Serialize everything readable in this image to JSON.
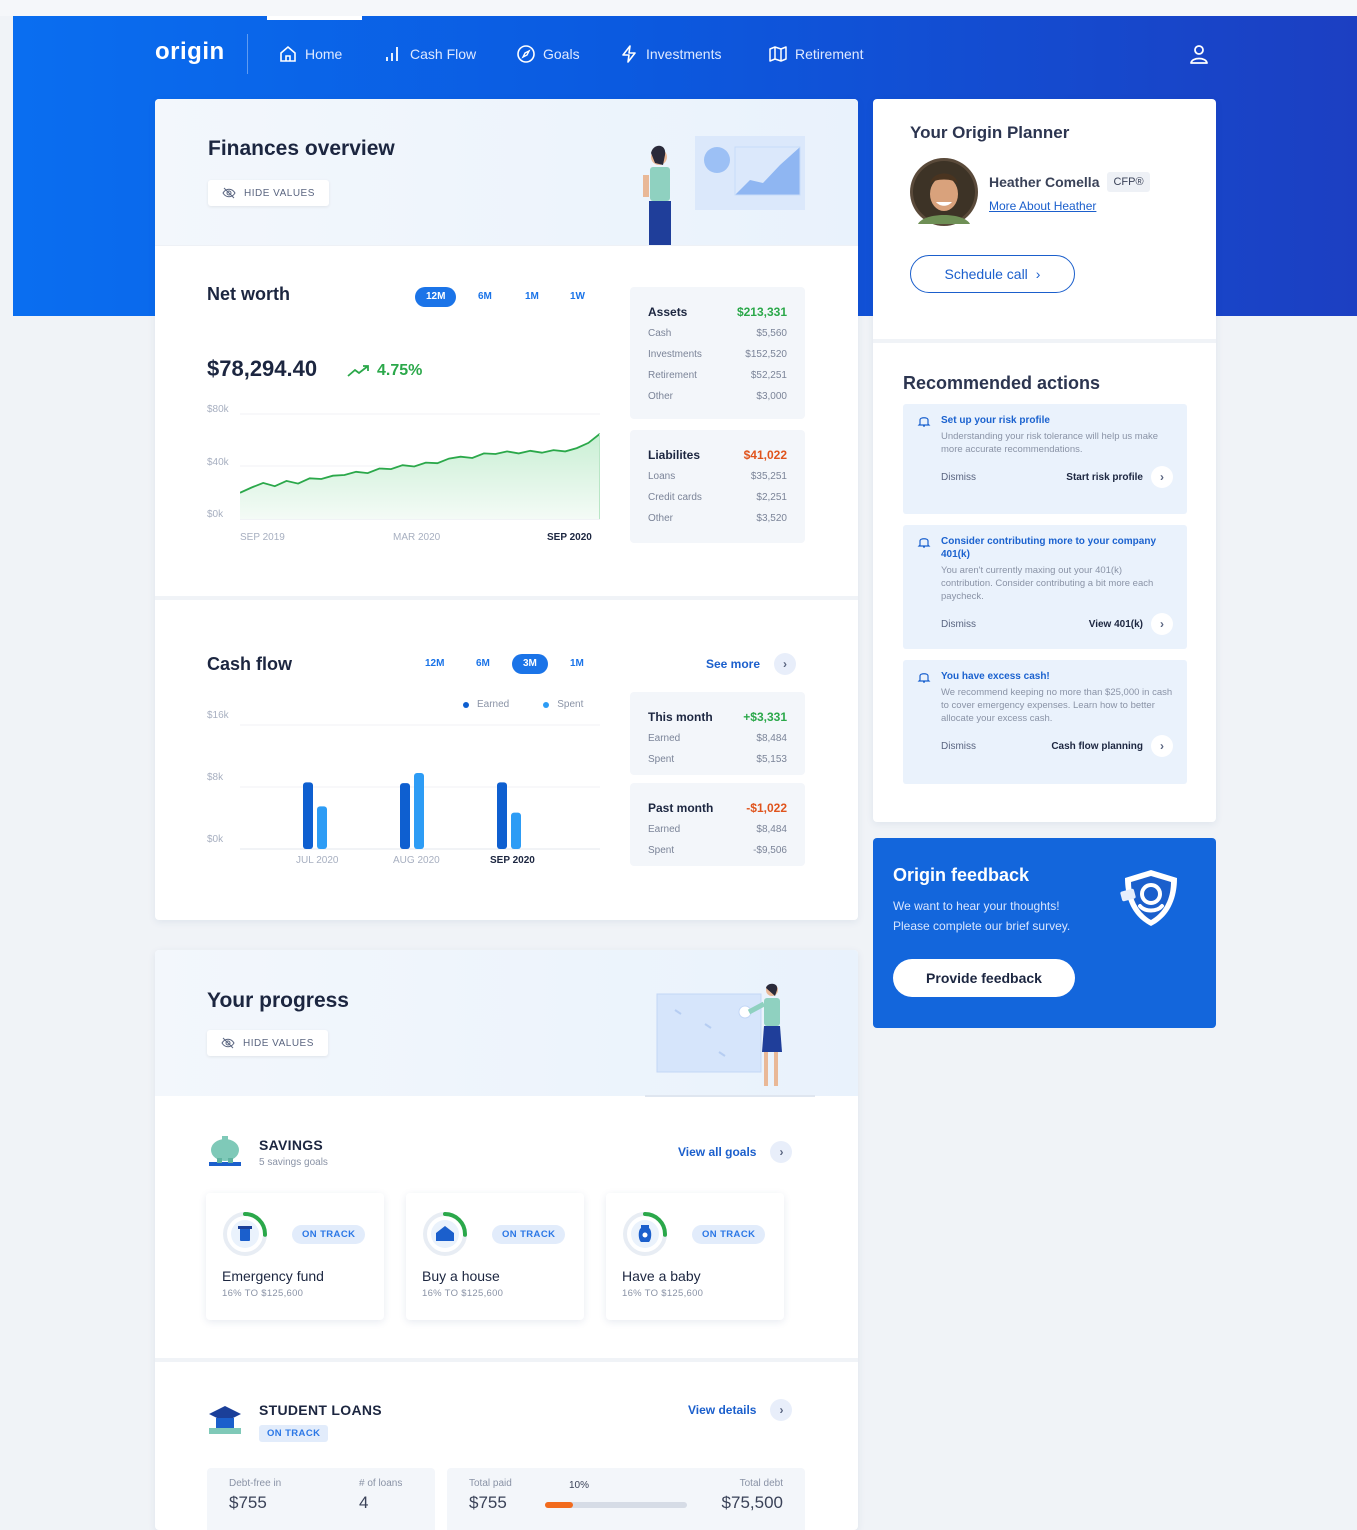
{
  "nav": {
    "logo": "origin",
    "items": [
      {
        "label": "Home",
        "icon": "home-icon"
      },
      {
        "label": "Cash Flow",
        "icon": "bar-chart-icon"
      },
      {
        "label": "Goals",
        "icon": "compass-icon"
      },
      {
        "label": "Investments",
        "icon": "lightning-icon"
      },
      {
        "label": "Retirement",
        "icon": "map-icon"
      }
    ],
    "user_icon": "user-icon"
  },
  "overview": {
    "title": "Finances overview",
    "hide_values": "HIDE VALUES"
  },
  "net_worth": {
    "title": "Net worth",
    "ranges": [
      "12M",
      "6M",
      "1M",
      "1W"
    ],
    "active_range": "12M",
    "value": "$78,294.40",
    "change": "4.75%",
    "assets": {
      "label": "Assets",
      "total": "$213,331",
      "rows": [
        {
          "label": "Cash",
          "value": "$5,560"
        },
        {
          "label": "Investments",
          "value": "$152,520"
        },
        {
          "label": "Retirement",
          "value": "$52,251"
        },
        {
          "label": "Other",
          "value": "$3,000"
        }
      ]
    },
    "liabilities": {
      "label": "Liabilites",
      "total": "$41,022",
      "rows": [
        {
          "label": "Loans",
          "value": "$35,251"
        },
        {
          "label": "Credit cards",
          "value": "$2,251"
        },
        {
          "label": "Other",
          "value": "$3,520"
        }
      ]
    }
  },
  "cash_flow": {
    "title": "Cash flow",
    "ranges": [
      "12M",
      "6M",
      "3M",
      "1M"
    ],
    "active_range": "3M",
    "see_more": "See more",
    "legend": {
      "earned": "Earned",
      "spent": "Spent"
    },
    "this_month": {
      "label": "This month",
      "total": "+$3,331",
      "rows": [
        {
          "label": "Earned",
          "value": "$8,484"
        },
        {
          "label": "Spent",
          "value": "$5,153"
        }
      ]
    },
    "past_month": {
      "label": "Past month",
      "total": "-$1,022",
      "rows": [
        {
          "label": "Earned",
          "value": "$8,484"
        },
        {
          "label": "Spent",
          "value": "-$9,506"
        }
      ]
    }
  },
  "chart_data": [
    {
      "type": "area",
      "title": "Net worth",
      "x_ticks": [
        "SEP 2019",
        "MAR 2020",
        "SEP 2020"
      ],
      "y_ticks": [
        "$80k",
        "$40k",
        "$0k"
      ],
      "ylim": [
        0,
        80000
      ],
      "values": [
        20000,
        24000,
        27500,
        25000,
        29000,
        27000,
        31000,
        30500,
        33000,
        33500,
        36000,
        35000,
        38500,
        38000,
        41000,
        40000,
        43000,
        42500,
        46000,
        47500,
        46500,
        50000,
        49500,
        51500,
        50000,
        52000,
        50500,
        52500,
        51500,
        54000,
        58000,
        65000
      ]
    },
    {
      "type": "bar",
      "title": "Cash flow",
      "categories": [
        "JUL 2020",
        "AUG 2020",
        "SEP 2020"
      ],
      "y_ticks": [
        "$16k",
        "$8k",
        "$0k"
      ],
      "ylim": [
        0,
        16000
      ],
      "series": [
        {
          "name": "Earned",
          "values": [
            8600,
            8500,
            8600
          ],
          "color": "#0e5fd0"
        },
        {
          "name": "Spent",
          "values": [
            5500,
            9800,
            4700
          ],
          "color": "#2d9cf5"
        }
      ]
    }
  ],
  "planner": {
    "title": "Your Origin Planner",
    "name": "Heather Comella",
    "credential": "CFP®",
    "link": "More About Heather",
    "schedule": "Schedule call"
  },
  "recommended": {
    "title": "Recommended actions",
    "items": [
      {
        "title": "Set up your risk profile",
        "desc": "Understanding your risk tolerance will help us make more accurate recommendations.",
        "dismiss": "Dismiss",
        "cta": "Start risk profile"
      },
      {
        "title": "Consider contributing more to your company 401(k)",
        "desc": "You aren't currently maxing out your 401(k) contribution. Consider contributing a bit more each paycheck.",
        "dismiss": "Dismiss",
        "cta": "View 401(k)"
      },
      {
        "title": "You have excess cash!",
        "desc": "We recommend keeping no more than $25,000 in cash to cover emergency expenses. Learn how to better allocate your excess cash.",
        "dismiss": "Dismiss",
        "cta": "Cash flow planning"
      }
    ]
  },
  "feedback": {
    "title": "Origin feedback",
    "line1": "We want to hear your thoughts!",
    "line2": "Please complete our brief survey.",
    "button": "Provide feedback"
  },
  "progress": {
    "title": "Your progress",
    "hide_values": "HIDE VALUES",
    "savings": {
      "label": "SAVINGS",
      "sub": "5 savings goals",
      "view_all": "View all goals",
      "goals": [
        {
          "name": "Emergency fund",
          "status": "ON TRACK",
          "detail": "16% TO $125,600",
          "progress": 0.16,
          "icon": "trash-can-icon"
        },
        {
          "name": "Buy a house",
          "status": "ON TRACK",
          "detail": "16% TO $125,600",
          "progress": 0.16,
          "icon": "house-icon"
        },
        {
          "name": "Have a baby",
          "status": "ON TRACK",
          "detail": "16% TO $125,600",
          "progress": 0.16,
          "icon": "baby-bottle-icon"
        }
      ]
    },
    "student_loans": {
      "label": "STUDENT LOANS",
      "status": "ON TRACK",
      "view_details": "View details",
      "debt_free_label": "Debt-free in",
      "debt_free_value": "$755",
      "loans_label": "# of loans",
      "loans_value": "4",
      "paid_label": "Total paid",
      "paid_value": "$755",
      "paid_pct_label": "10%",
      "paid_fraction": 0.1,
      "debt_label": "Total debt",
      "debt_value": "$75,500"
    }
  }
}
